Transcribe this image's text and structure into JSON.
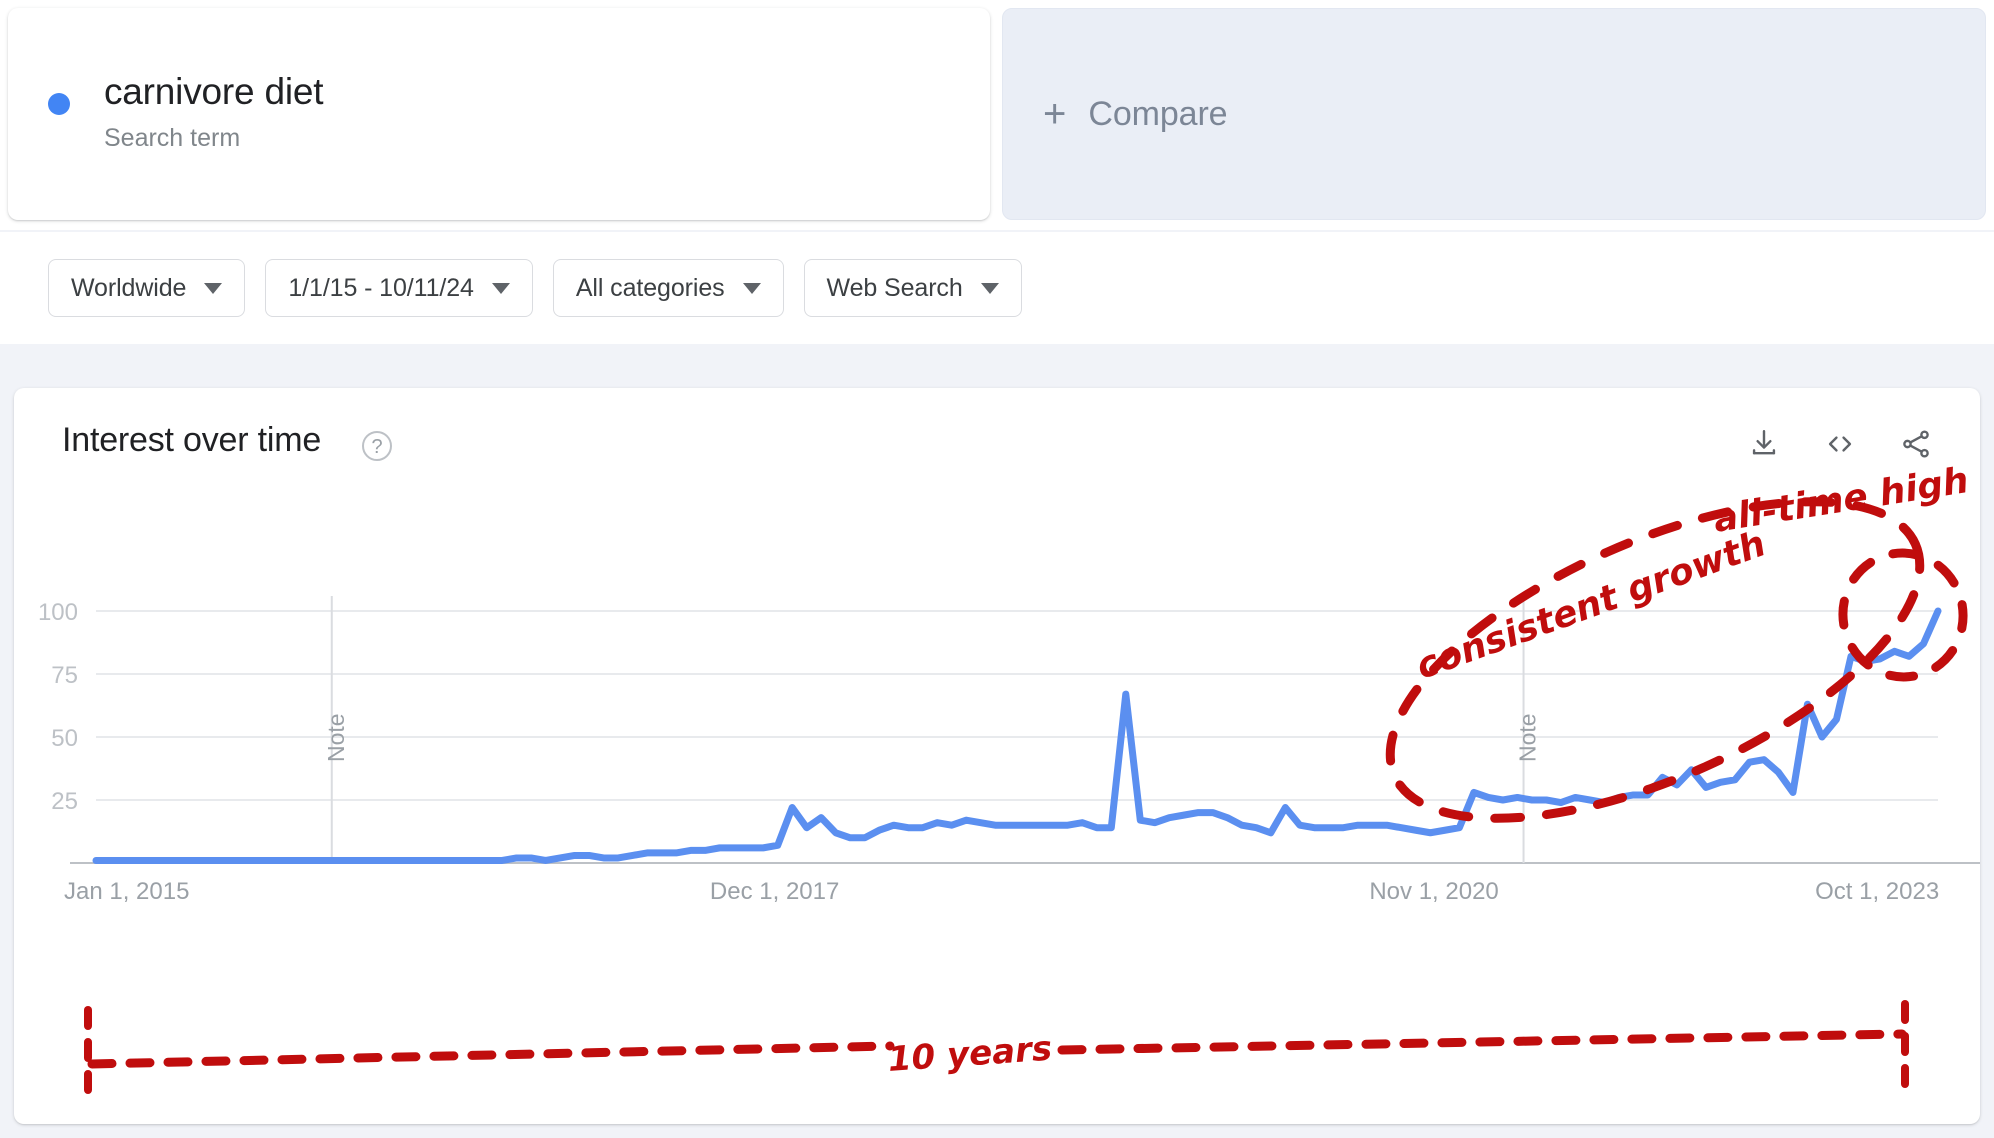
{
  "search_term": {
    "name": "carnivore diet",
    "type_label": "Search term",
    "dot_color": "#4285f4"
  },
  "compare": {
    "plus_glyph": "+",
    "label": "Compare"
  },
  "filters": [
    {
      "label": "Worldwide",
      "name": "location-filter"
    },
    {
      "label": "1/1/15 - 10/11/24",
      "name": "time-range-filter"
    },
    {
      "label": "All categories",
      "name": "category-filter"
    },
    {
      "label": "Web Search",
      "name": "search-type-filter"
    }
  ],
  "chart_panel": {
    "title": "Interest over time",
    "help_glyph": "?",
    "tools": [
      {
        "name": "download-icon"
      },
      {
        "name": "embed-code-icon"
      },
      {
        "name": "share-icon"
      }
    ],
    "note_labels": [
      "Note",
      "Note"
    ]
  },
  "annotations": {
    "all_time_high": "all-time high",
    "consistent_growth": "consistent growth",
    "ten_years": "10 years",
    "ink_color": "#c00d0d"
  },
  "chart_data": {
    "type": "line",
    "title": "Interest over time",
    "xlabel": "",
    "ylabel": "",
    "ylim": [
      0,
      100
    ],
    "yticks": [
      25,
      50,
      75,
      100
    ],
    "grid": true,
    "legend": "none",
    "line_color": "#5b8ff0",
    "x_tick_labels": [
      "Jan 1, 2015",
      "Dec 1, 2017",
      "Nov 1, 2020",
      "Oct 1, 2023"
    ],
    "x_tick_positions_pct": [
      0.0,
      0.355,
      0.713,
      0.955
    ],
    "x_range": [
      "Jan 1, 2015",
      "Oct 2024"
    ],
    "note_markers_pct": [
      0.128,
      0.775
    ],
    "series": [
      {
        "name": "carnivore diet",
        "values": [
          1,
          1,
          1,
          1,
          1,
          1,
          1,
          1,
          1,
          1,
          1,
          1,
          1,
          1,
          1,
          1,
          1,
          1,
          1,
          1,
          1,
          1,
          1,
          1,
          1,
          1,
          1,
          1,
          1,
          2,
          2,
          1,
          2,
          3,
          3,
          2,
          2,
          3,
          4,
          4,
          4,
          5,
          5,
          6,
          6,
          6,
          6,
          7,
          22,
          14,
          18,
          12,
          10,
          10,
          13,
          15,
          14,
          14,
          16,
          15,
          17,
          16,
          15,
          15,
          15,
          15,
          15,
          15,
          16,
          14,
          14,
          67,
          17,
          16,
          18,
          19,
          20,
          20,
          18,
          15,
          14,
          12,
          22,
          15,
          14,
          14,
          14,
          15,
          15,
          15,
          14,
          13,
          12,
          13,
          14,
          28,
          26,
          25,
          26,
          25,
          25,
          24,
          26,
          25,
          24,
          26,
          27,
          27,
          34,
          31,
          37,
          30,
          32,
          33,
          40,
          41,
          36,
          28,
          63,
          50,
          57,
          82,
          80,
          81,
          84,
          82,
          87,
          100
        ]
      }
    ]
  }
}
